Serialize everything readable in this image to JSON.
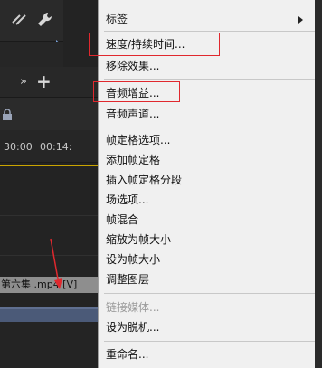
{
  "timeline": {
    "timecode_left": "30:00",
    "timecode_right": "00:14:",
    "clip_label": "第六集 .mp4 [V]",
    "colors": {
      "playhead_line": "#c9a400",
      "clip_audio": "#4b5a78",
      "annotation": "#e0282e"
    }
  },
  "menu": {
    "items": [
      {
        "label": "标签",
        "has_submenu": true,
        "disabled": false
      },
      {
        "label": "速度/持续时间...",
        "has_submenu": false,
        "disabled": false,
        "highlighted": true
      },
      {
        "label": "移除效果...",
        "has_submenu": false,
        "disabled": false
      },
      {
        "label": "音频增益...",
        "has_submenu": false,
        "disabled": false,
        "highlighted": true
      },
      {
        "label": "音频声道...",
        "has_submenu": false,
        "disabled": false
      },
      {
        "label": "帧定格选项...",
        "has_submenu": false,
        "disabled": false
      },
      {
        "label": "添加帧定格",
        "has_submenu": false,
        "disabled": false
      },
      {
        "label": "插入帧定格分段",
        "has_submenu": false,
        "disabled": false
      },
      {
        "label": "场选项...",
        "has_submenu": false,
        "disabled": false
      },
      {
        "label": "帧混合",
        "has_submenu": false,
        "disabled": false
      },
      {
        "label": "缩放为帧大小",
        "has_submenu": false,
        "disabled": false
      },
      {
        "label": "设为帧大小",
        "has_submenu": false,
        "disabled": false
      },
      {
        "label": "调整图层",
        "has_submenu": false,
        "disabled": false
      },
      {
        "label": "链接媒体...",
        "has_submenu": false,
        "disabled": true
      },
      {
        "label": "设为脱机...",
        "has_submenu": false,
        "disabled": false
      },
      {
        "label": "重命名...",
        "has_submenu": false,
        "disabled": false
      }
    ]
  }
}
